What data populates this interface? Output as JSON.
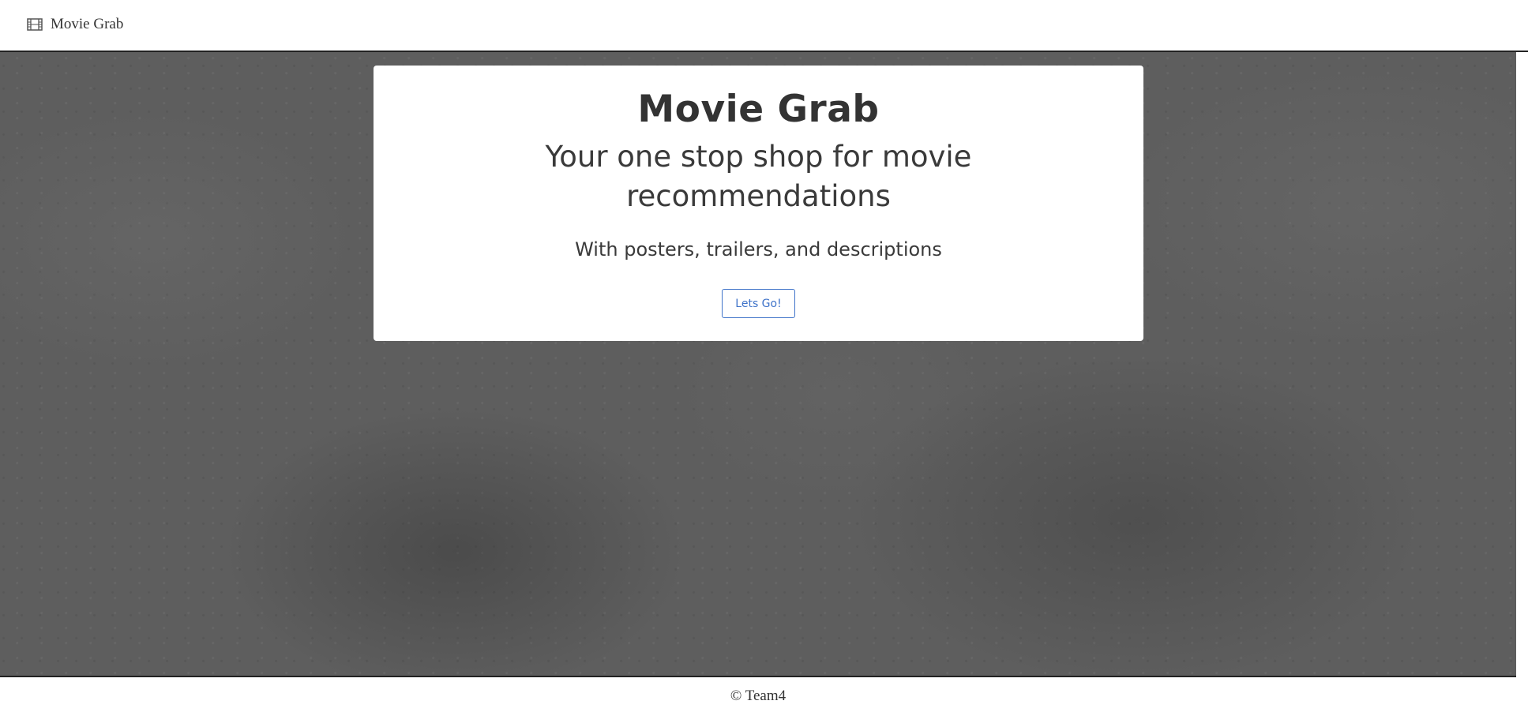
{
  "navbar": {
    "brand_icon": "film-icon",
    "brand_label": "Movie Grab"
  },
  "hero": {
    "title": "Movie Grab",
    "subtitle": "Your one stop shop for movie recommendations",
    "tagline": "With posters, trailers, and descriptions",
    "cta_label": "Lets Go!"
  },
  "footer": {
    "text": "© Team4"
  },
  "colors": {
    "accent": "#3f73c9",
    "text": "#333333",
    "background": "#5e5e5e"
  }
}
